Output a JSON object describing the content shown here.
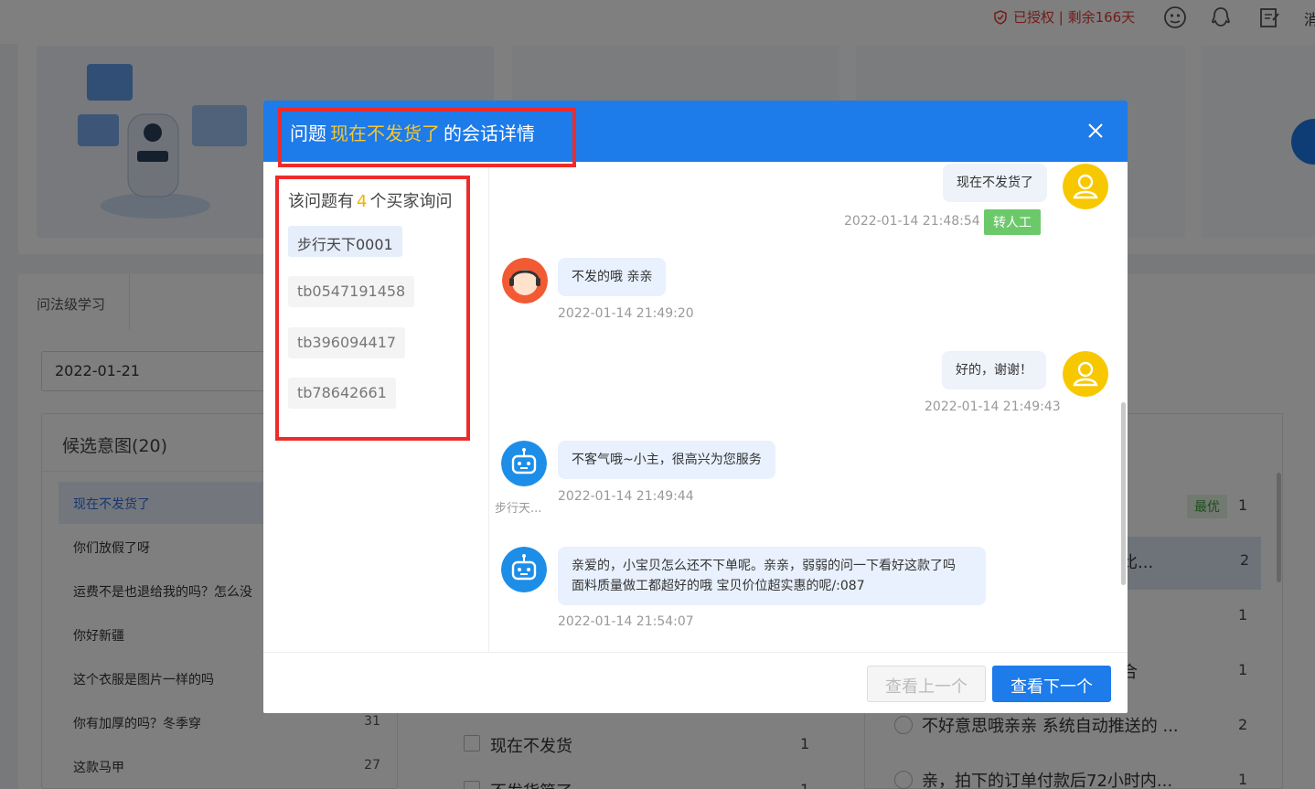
{
  "header": {
    "auth_text": "已授权 | 剩余166天",
    "cut_text": "消"
  },
  "background": {
    "tab_label": "问法级学习",
    "date_value": "2022-01-21",
    "candidate_title": "候选意图(20)",
    "candidates": [
      {
        "label": "现在不发货了",
        "count": ""
      },
      {
        "label": "你们放假了呀",
        "count": ""
      },
      {
        "label": "运费不是也退给我的吗？怎么没",
        "count": ""
      },
      {
        "label": "你好新疆",
        "count": ""
      },
      {
        "label": "这个衣服是图片一样的吗",
        "count": ""
      },
      {
        "label": "你有加厚的吗？冬季穿",
        "count": "31"
      },
      {
        "label": "这款马甲",
        "count": "27"
      }
    ],
    "mid_items": [
      {
        "label": "现在不发货",
        "count": "1"
      },
      {
        "label": "不发货简了",
        "count": "1"
      }
    ],
    "right_items": [
      {
        "label": "",
        "badge": "最优",
        "count": "1"
      },
      {
        "label": "比...",
        "count": "2"
      },
      {
        "label": "",
        "count": "1"
      },
      {
        "label": "合",
        "count": "1"
      },
      {
        "label": "不好意思哦亲亲 系统自动推送的 ...",
        "count": "2"
      },
      {
        "label": "亲，拍下的订单付款后72小时内...",
        "count": "1"
      }
    ]
  },
  "modal": {
    "title_prefix": "问题",
    "title_highlight": "现在不发货了",
    "title_suffix": "的会话详情",
    "buyer_head_prefix": "该问题有",
    "buyer_count": "4",
    "buyer_head_suffix": "个买家询问",
    "buyers": [
      "步行天下0001",
      "tb0547191458",
      "tb396094417",
      "tb78642661"
    ],
    "messages": [
      {
        "role": "buyer",
        "text": "现在不发货了",
        "time": "2022-01-14 21:48:54",
        "badge": "转人工"
      },
      {
        "role": "agent",
        "text": "不发的哦 亲亲",
        "time": "2022-01-14 21:49:20"
      },
      {
        "role": "buyer",
        "text": "好的，谢谢！",
        "time": "2022-01-14 21:49:43"
      },
      {
        "role": "bot",
        "text": "不客气哦~小主，很高兴为您服务",
        "time": "2022-01-14 21:49:44",
        "name": "步行天..."
      },
      {
        "role": "bot",
        "text": "亲爱的，小宝贝怎么还不下单呢。亲亲，弱弱的问一下看好这款了吗 面料质量做工都超好的哦 宝贝价位超实惠的呢/:087",
        "time": "2022-01-14 21:54:07"
      }
    ],
    "prev_label": "查看上一个",
    "next_label": "查看下一个"
  }
}
